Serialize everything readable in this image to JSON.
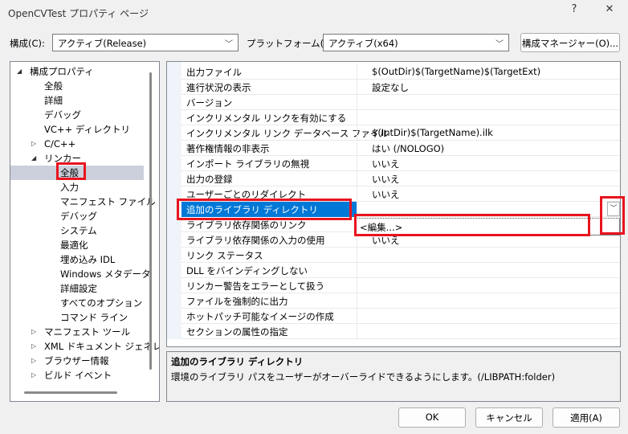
{
  "window": {
    "title": "OpenCVTest プロパティ ページ",
    "help": "?",
    "close": "✕"
  },
  "toolbar": {
    "config_label": "構成(C):",
    "config_value": "アクティブ(Release)",
    "platform_label": "プラットフォーム(P):",
    "platform_value": "アクティブ(x64)",
    "manager_button": "構成マネージャー(O)..."
  },
  "tree": [
    {
      "label": "構成プロパティ",
      "level": 0,
      "arrow": "◢"
    },
    {
      "label": "全般",
      "level": 1
    },
    {
      "label": "詳細",
      "level": 1
    },
    {
      "label": "デバッグ",
      "level": 1
    },
    {
      "label": "VC++ ディレクトリ",
      "level": 1
    },
    {
      "label": "C/C++",
      "level": 1,
      "arrow": "▷"
    },
    {
      "label": "リンカー",
      "level": 1,
      "arrow": "◢"
    },
    {
      "label": "全般",
      "level": 2,
      "selected": true
    },
    {
      "label": "入力",
      "level": 2
    },
    {
      "label": "マニフェスト ファイル",
      "level": 2
    },
    {
      "label": "デバッグ",
      "level": 2
    },
    {
      "label": "システム",
      "level": 2
    },
    {
      "label": "最適化",
      "level": 2
    },
    {
      "label": "埋め込み IDL",
      "level": 2
    },
    {
      "label": "Windows メタデータ",
      "level": 2
    },
    {
      "label": "詳細設定",
      "level": 2
    },
    {
      "label": "すべてのオプション",
      "level": 2
    },
    {
      "label": "コマンド ライン",
      "level": 2
    },
    {
      "label": "マニフェスト ツール",
      "level": 1,
      "arrow": "▷"
    },
    {
      "label": "XML ドキュメント ジェネレー",
      "level": 1,
      "arrow": "▷"
    },
    {
      "label": "ブラウザー情報",
      "level": 1,
      "arrow": "▷"
    },
    {
      "label": "ビルド イベント",
      "level": 1,
      "arrow": "▷"
    }
  ],
  "properties": [
    {
      "name": "出力ファイル",
      "value": "$(OutDir)$(TargetName)$(TargetExt)"
    },
    {
      "name": "進行状況の表示",
      "value": "設定なし"
    },
    {
      "name": "バージョン",
      "value": ""
    },
    {
      "name": "インクリメンタル リンクを有効にする",
      "value": ""
    },
    {
      "name": "インクリメンタル リンク データベース ファイル",
      "value": "$(IntDir)$(TargetName).ilk"
    },
    {
      "name": "著作権情報の非表示",
      "value": "はい (/NOLOGO)"
    },
    {
      "name": "インポート ライブラリの無視",
      "value": "いいえ"
    },
    {
      "name": "出力の登録",
      "value": "いいえ"
    },
    {
      "name": "ユーザーごとのリダイレクト",
      "value": "いいえ"
    },
    {
      "name": "追加のライブラリ ディレクトリ",
      "value": "",
      "selected": true
    },
    {
      "name": "ライブラリ依存関係のリンク",
      "value": ""
    },
    {
      "name": "ライブラリ依存関係の入力の使用",
      "value": "いいえ"
    },
    {
      "name": "リンク ステータス",
      "value": ""
    },
    {
      "name": "DLL をバインディングしない",
      "value": ""
    },
    {
      "name": "リンカー警告をエラーとして扱う",
      "value": ""
    },
    {
      "name": "ファイルを強制的に出力",
      "value": ""
    },
    {
      "name": "ホットパッチ可能なイメージの作成",
      "value": ""
    },
    {
      "name": "セクションの属性の指定",
      "value": ""
    }
  ],
  "dropdown": {
    "option": "<編集...>"
  },
  "description": {
    "title": "追加のライブラリ ディレクトリ",
    "text": "環境のライブラリ パスをユーザーがオーバーライドできるようにします。(/LIBPATH:folder)"
  },
  "buttons": {
    "ok": "OK",
    "cancel": "キャンセル",
    "apply": "適用(A)"
  },
  "colors": {
    "selection": "#0078d7",
    "highlight": "#e8141e"
  }
}
